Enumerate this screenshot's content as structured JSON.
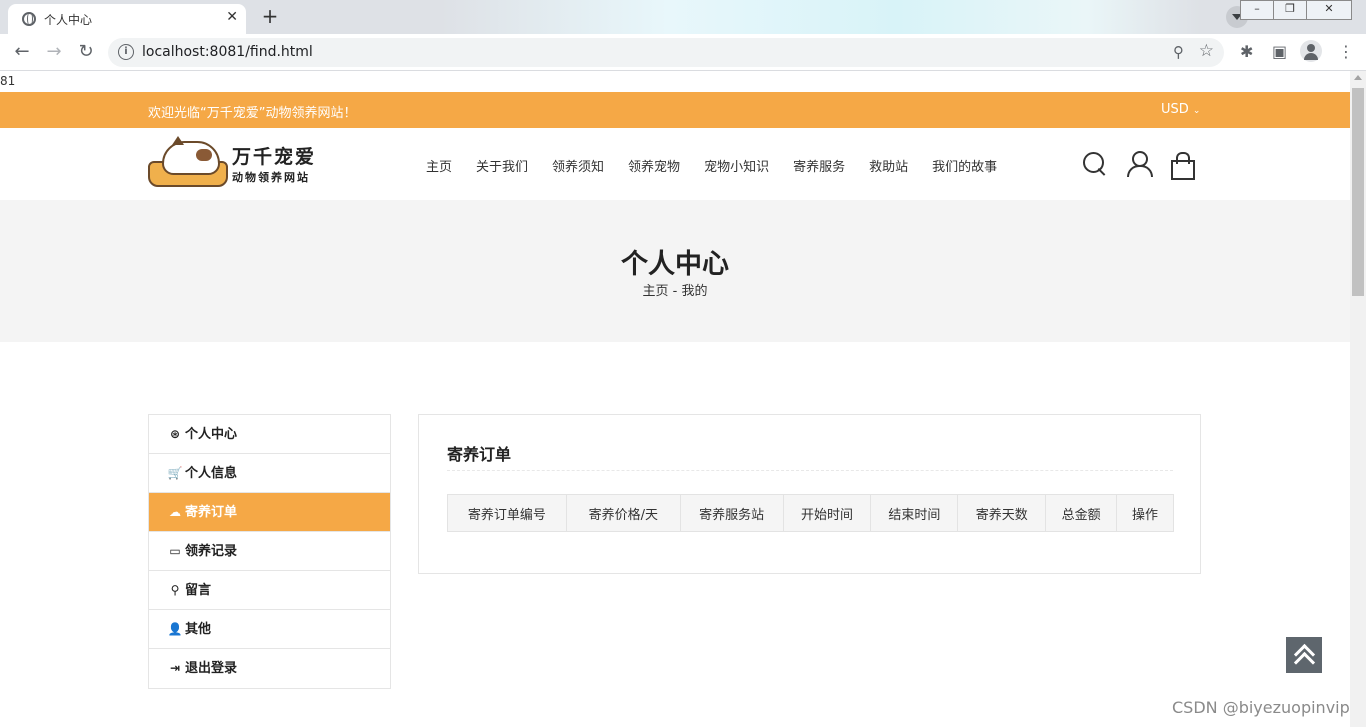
{
  "browser": {
    "tab_title": "个人中心",
    "tab_close": "✕",
    "new_tab": "+",
    "url": "localhost:8081/find.html",
    "win_minimize": "–",
    "win_restore": "❐",
    "win_close": "✕"
  },
  "page": {
    "debug_text": "81",
    "topbar": {
      "welcome": "欢迎光临“万千宠爱”动物领养网站！",
      "currency": "USD"
    },
    "logo": {
      "name": "万千宠爱",
      "subtitle": "动物领养网站"
    },
    "nav": [
      "主页",
      "关于我们",
      "领养须知",
      "领养宠物",
      "宠物小知识",
      "寄养服务",
      "救助站",
      "我们的故事"
    ],
    "banner": {
      "title": "个人中心",
      "crumb_home": "主页",
      "crumb_sep": "-",
      "crumb_current": "我的"
    },
    "sidebar": [
      {
        "label": "个人中心",
        "icon": "dashboard-icon",
        "glyph": "⊛",
        "active": false
      },
      {
        "label": "个人信息",
        "icon": "cart-icon",
        "glyph": "🛒",
        "active": false
      },
      {
        "label": "寄养订单",
        "icon": "cloud-download-icon",
        "glyph": "☁",
        "active": true
      },
      {
        "label": "领养记录",
        "icon": "credit-card-icon",
        "glyph": "▭",
        "active": false
      },
      {
        "label": "留言",
        "icon": "map-marker-icon",
        "glyph": "⚲",
        "active": false
      },
      {
        "label": "其他",
        "icon": "user-icon",
        "glyph": "👤",
        "active": false
      },
      {
        "label": "退出登录",
        "icon": "sign-out-icon",
        "glyph": "⇥",
        "active": false
      }
    ],
    "content": {
      "heading": "寄养订单",
      "columns": [
        "寄养订单编号",
        "寄养价格/天",
        "寄养服务站",
        "开始时间",
        "结束时间",
        "寄养天数",
        "总金额",
        "操作"
      ]
    },
    "watermark": "CSDN @biyezuopinvip"
  },
  "colors": {
    "accent": "#f5a846",
    "banner_bg": "#f4f4f4",
    "back_top": "#5e666d"
  }
}
